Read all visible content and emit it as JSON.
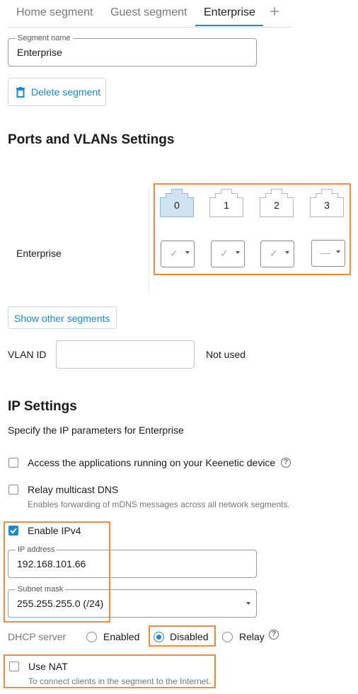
{
  "tabs": {
    "items": [
      {
        "label": "Home segment"
      },
      {
        "label": "Guest segment"
      },
      {
        "label": "Enterprise"
      }
    ],
    "add_label": "+"
  },
  "segment_name": {
    "legend": "Segment name",
    "value": "Enterprise"
  },
  "delete_button": {
    "label": "Delete segment",
    "icon": "trash-icon"
  },
  "ports_section": {
    "title": "Ports and VLANs Settings",
    "segment_label": "Enterprise",
    "ports": [
      {
        "number": "0",
        "selected": true
      },
      {
        "number": "1",
        "selected": false
      },
      {
        "number": "2",
        "selected": false
      },
      {
        "number": "3",
        "selected": false
      }
    ],
    "port_modes": [
      {
        "symbol": "✓"
      },
      {
        "symbol": "✓"
      },
      {
        "symbol": "✓"
      },
      {
        "symbol": "—"
      }
    ],
    "show_other_label": "Show other segments",
    "vlan_label": "VLAN ID",
    "vlan_value": "",
    "vlan_status": "Not used"
  },
  "ip_section": {
    "title": "IP Settings",
    "subtitle": "Specify the IP parameters for Enterprise",
    "access_apps": {
      "label": "Access the applications running on your Keenetic device",
      "checked": false
    },
    "relay_mdns": {
      "label": "Relay multicast DNS",
      "description": "Enables forwarding of mDNS messages across all network segments.",
      "checked": false
    },
    "enable_ipv4": {
      "label": "Enable IPv4",
      "checked": true
    },
    "ip_address": {
      "legend": "IP address",
      "value": "192.168.101.66"
    },
    "subnet_mask": {
      "legend": "Subnet mask",
      "value": "255.255.255.0 (/24)"
    },
    "dhcp": {
      "label": "DHCP server",
      "options": [
        {
          "label": "Enabled",
          "selected": false
        },
        {
          "label": "Disabled",
          "selected": true
        },
        {
          "label": "Relay",
          "selected": false
        }
      ]
    },
    "use_nat": {
      "label": "Use NAT",
      "description": "To connect clients in the segment to the Internet.",
      "checked": false
    }
  },
  "colors": {
    "accent": "#1e88c8",
    "highlight": "#f08a3c",
    "port_selected": "#cfe3f2"
  }
}
